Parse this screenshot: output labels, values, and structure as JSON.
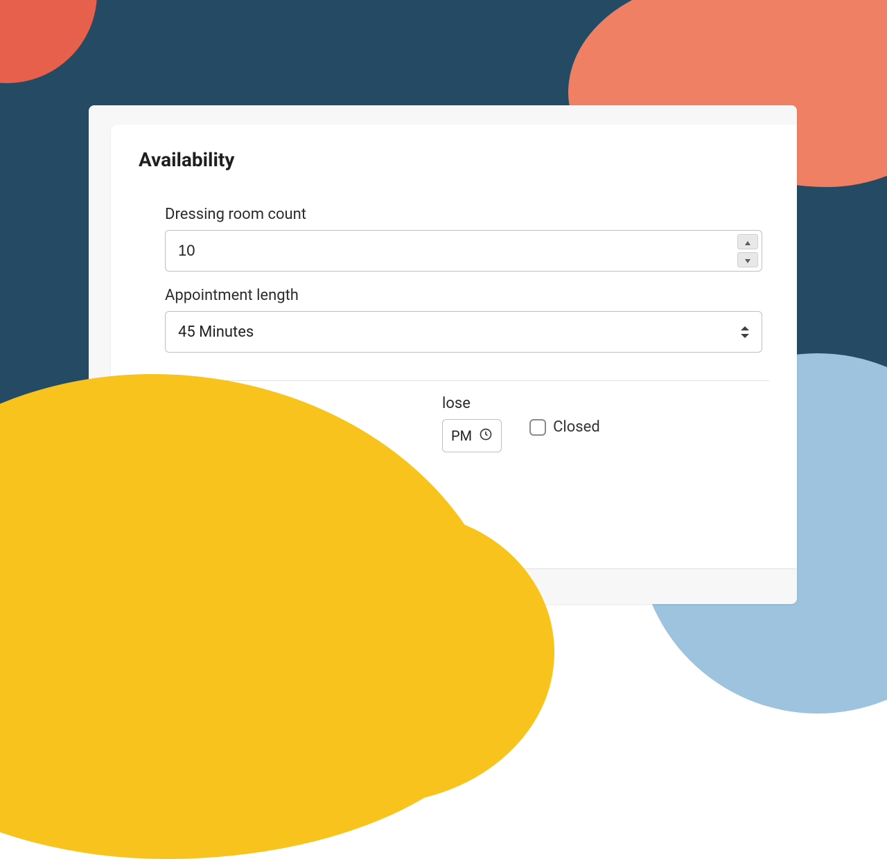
{
  "card": {
    "title": "Availability",
    "dressing_room": {
      "label": "Dressing room count",
      "value": "10"
    },
    "appointment_length": {
      "label": "Appointment length",
      "value": "45 Minutes"
    },
    "close": {
      "label": "lose",
      "value": "PM"
    },
    "closed": {
      "label": "Closed"
    }
  },
  "colors": {
    "bg": "#244b63",
    "coral": "#f08064",
    "red": "#e7604c",
    "yellow": "#f8c31c",
    "lightblue": "#9dc3df"
  }
}
